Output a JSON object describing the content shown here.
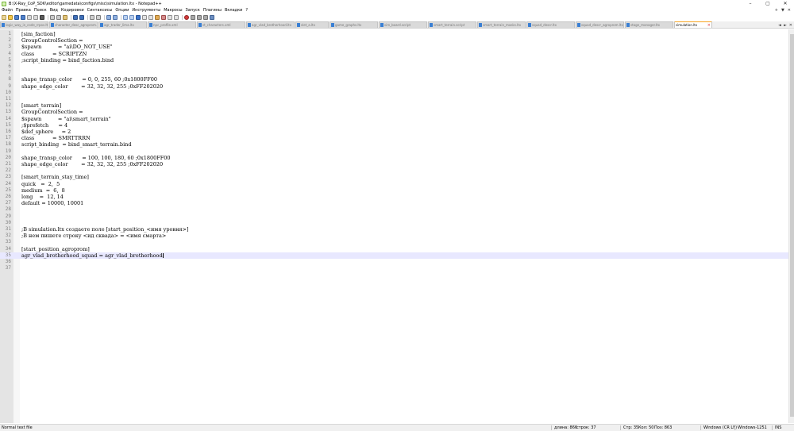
{
  "window": {
    "title": "B:\\X-Ray_CoP_SDK\\editor\\gamedata\\configs\\misc\\simulation.ltx - Notepad++",
    "controls": [
      "–",
      "▢",
      "✕"
    ]
  },
  "menu": {
    "items": [
      "Файл",
      "Правка",
      "Поиск",
      "Вид",
      "Кодировки",
      "Синтаксисы",
      "Опции",
      "Инструменты",
      "Макросы",
      "Запуск",
      "Плагины",
      "Вкладки",
      "?"
    ],
    "right": [
      "+",
      "▼",
      "✕"
    ]
  },
  "tabs": [
    {
      "label": "logic_way_in_code_rrpos.ltx",
      "active": false
    },
    {
      "label": "character_desc_agroprom.xml",
      "active": false
    },
    {
      "label": "agr_trader_lima.ltx",
      "active": false
    },
    {
      "label": "npc_profile.xml",
      "active": false
    },
    {
      "label": "st_characters.xml",
      "active": false
    },
    {
      "label": "agr_vlad_brotherhood.ltx",
      "active": false
    },
    {
      "label": "slet_a.ltx",
      "active": false
    },
    {
      "label": "game_graphs.ltx",
      "active": false
    },
    {
      "label": "sim_board.script",
      "active": false
    },
    {
      "label": "smart_terrain.script",
      "active": false
    },
    {
      "label": "smart_terrain_masks.ltx",
      "active": false
    },
    {
      "label": "squad_descr.ltx",
      "active": false
    },
    {
      "label": "squad_descr_agroprom.ltx",
      "active": false
    },
    {
      "label": "stage_manager.ltx",
      "active": false
    },
    {
      "label": "simulation.ltx",
      "active": true
    }
  ],
  "tab_nav": [
    "◄",
    "►",
    "✕"
  ],
  "editor": {
    "current_line": 35,
    "lines": [
      "[sim_faction]",
      "GroupControlSection =",
      "$spawn          = \"ai\\DO_NOT_USE\"",
      "class           = SCRIPTZN",
      ";script_binding = bind_faction.bind",
      "",
      "",
      "shape_transp_color      = 0, 0, 255, 60 ;0x1800FF00",
      "shape_edge_color        = 32, 32, 32, 255 ;0xFF202020",
      "",
      "",
      "[smart_terrain]",
      "GroupControlSection =",
      "$spawn          = \"ai\\smart_terrain\"",
      ";$prefetch      = 4",
      "$def_sphere     = 2",
      "class           = SMRTTRRN",
      "script_binding  = bind_smart_terrain.bind",
      "",
      "shape_transp_color      = 100, 100, 180, 60 ;0x1800FF00",
      "shape_edge_color        = 32, 32, 32, 255 ;0xFF202020",
      "",
      "[smart_terrain_stay_time]",
      "quick   =  2,  5",
      "medium  =  6,  8",
      "long    =  12, 14",
      "default = 10000, 10001",
      "",
      "",
      "",
      ";В simulation.ltx создаете поле [start_position_<имя уровня>]",
      ";В нем пишете строку <ид сквада> = <имя смарта>",
      "",
      "[start_position_agroprom]",
      "agr_vlad_brotherhood_squad = agr_vlad_brotherhood",
      "",
      ""
    ]
  },
  "status": {
    "file_type": "Normal text file",
    "length": "длина: 866",
    "lines": "строк: 37",
    "ln": "Стр: 35",
    "col": "Кол: 50",
    "pos": "Поз: 863",
    "eol": "Windows (CR LF)",
    "encoding": "Windows-1251",
    "mode": "INS"
  },
  "colors": {
    "current_line": "#e8e8ff",
    "tab_active_accent": "#f7a520",
    "gutter": "#e4e4e4",
    "tab_icon": "#3a7fd3"
  }
}
